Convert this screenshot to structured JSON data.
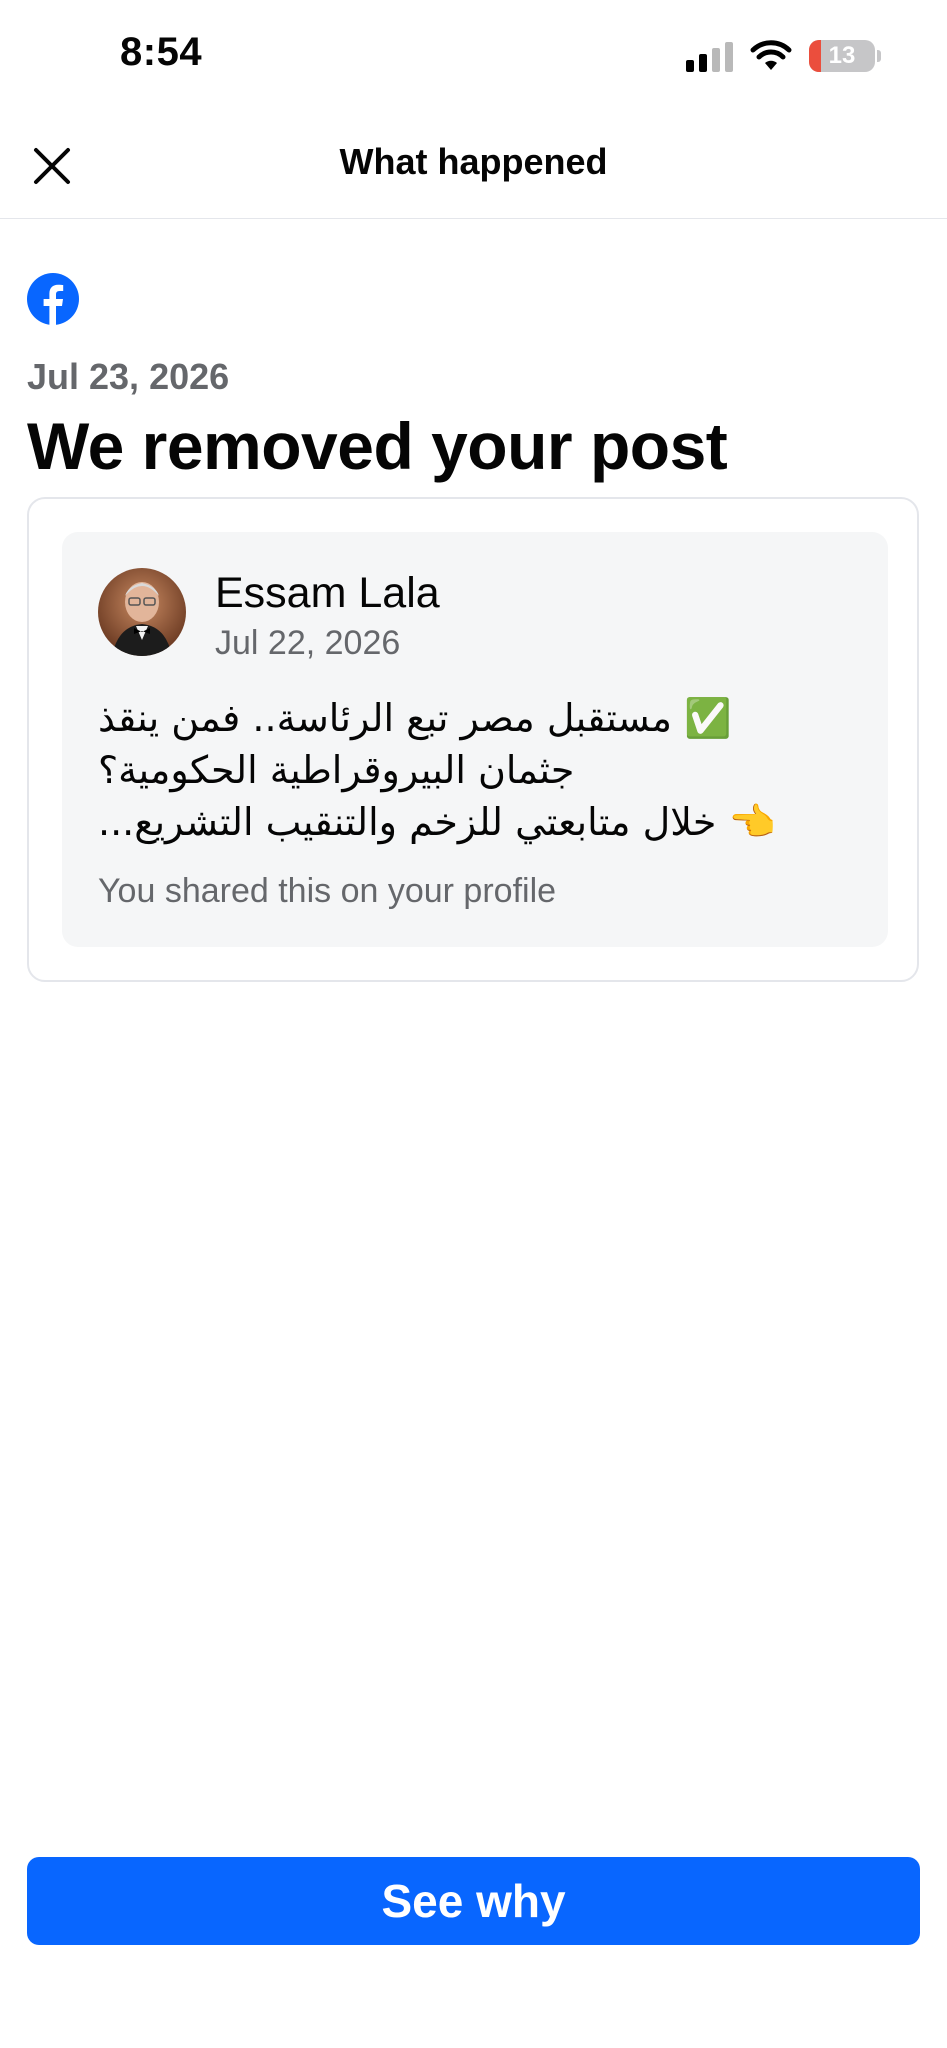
{
  "status_bar": {
    "time": "8:54",
    "battery_level": "13",
    "icons": [
      "cellular-signal-icon",
      "wifi-icon",
      "battery-icon"
    ]
  },
  "nav": {
    "title": "What happened",
    "close_icon": "close-icon"
  },
  "notice": {
    "app_icon": "facebook-logo",
    "date": "Jul 23, 2026",
    "title": "We removed your post"
  },
  "post": {
    "author": "Essam Lala",
    "date": "Jul 22, 2026",
    "lines": [
      "✅ مستقبل مصر تبع الرئاسة.. فمن ينقذ",
      "جثمان البيروقراطية الحكومية؟",
      "👈 خلال متابعتي للزخم والتنقيب التشريع..."
    ],
    "shared_note": "You shared this on your profile"
  },
  "action": {
    "label": "See why"
  },
  "colors": {
    "brand_blue": "#0866ff",
    "secondary_text": "#65676b",
    "card_bg": "#f5f6f7",
    "battery_low": "#eb4e3d"
  }
}
